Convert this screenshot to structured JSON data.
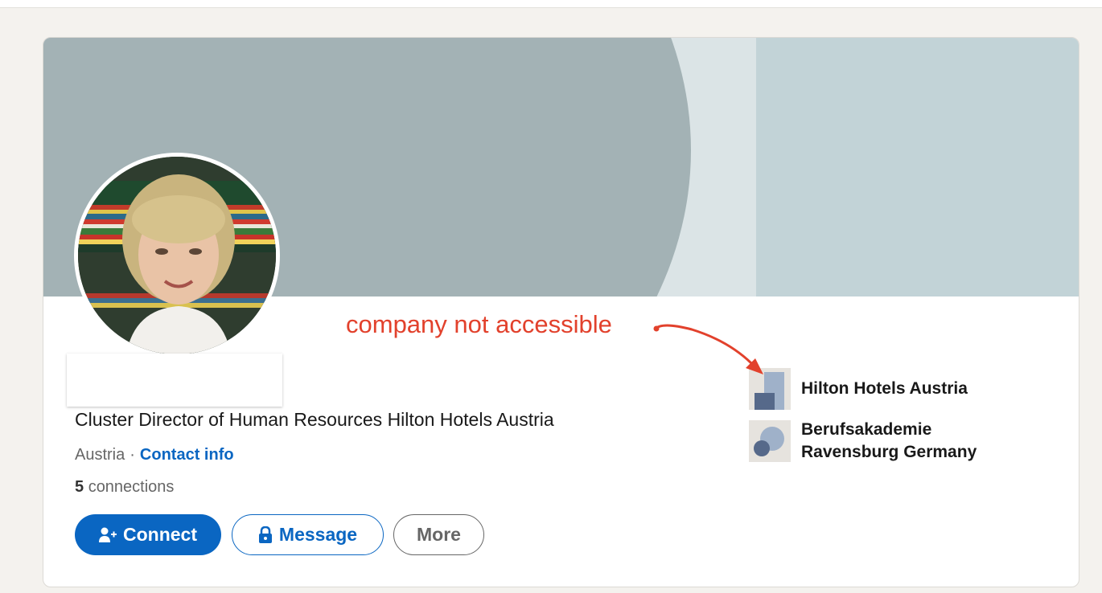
{
  "profile": {
    "headline": "Cluster Director of Human Resources Hilton Hotels Austria",
    "location": "Austria",
    "separator": "·",
    "contact_link": "Contact info",
    "connections_count": "5",
    "connections_label": "connections"
  },
  "actions": {
    "connect_label": "Connect",
    "message_label": "Message",
    "more_label": "More"
  },
  "organizations": [
    {
      "name": "Hilton Hotels Austria",
      "logo": "building-icon"
    },
    {
      "name": "Berufsakademie Ravensburg Germany",
      "logo": "school-icon"
    }
  ],
  "annotation": {
    "text": "company not accessible",
    "color": "#e2412c"
  },
  "colors": {
    "accent": "#0a66c2",
    "page_background": "#f4f2ee"
  }
}
